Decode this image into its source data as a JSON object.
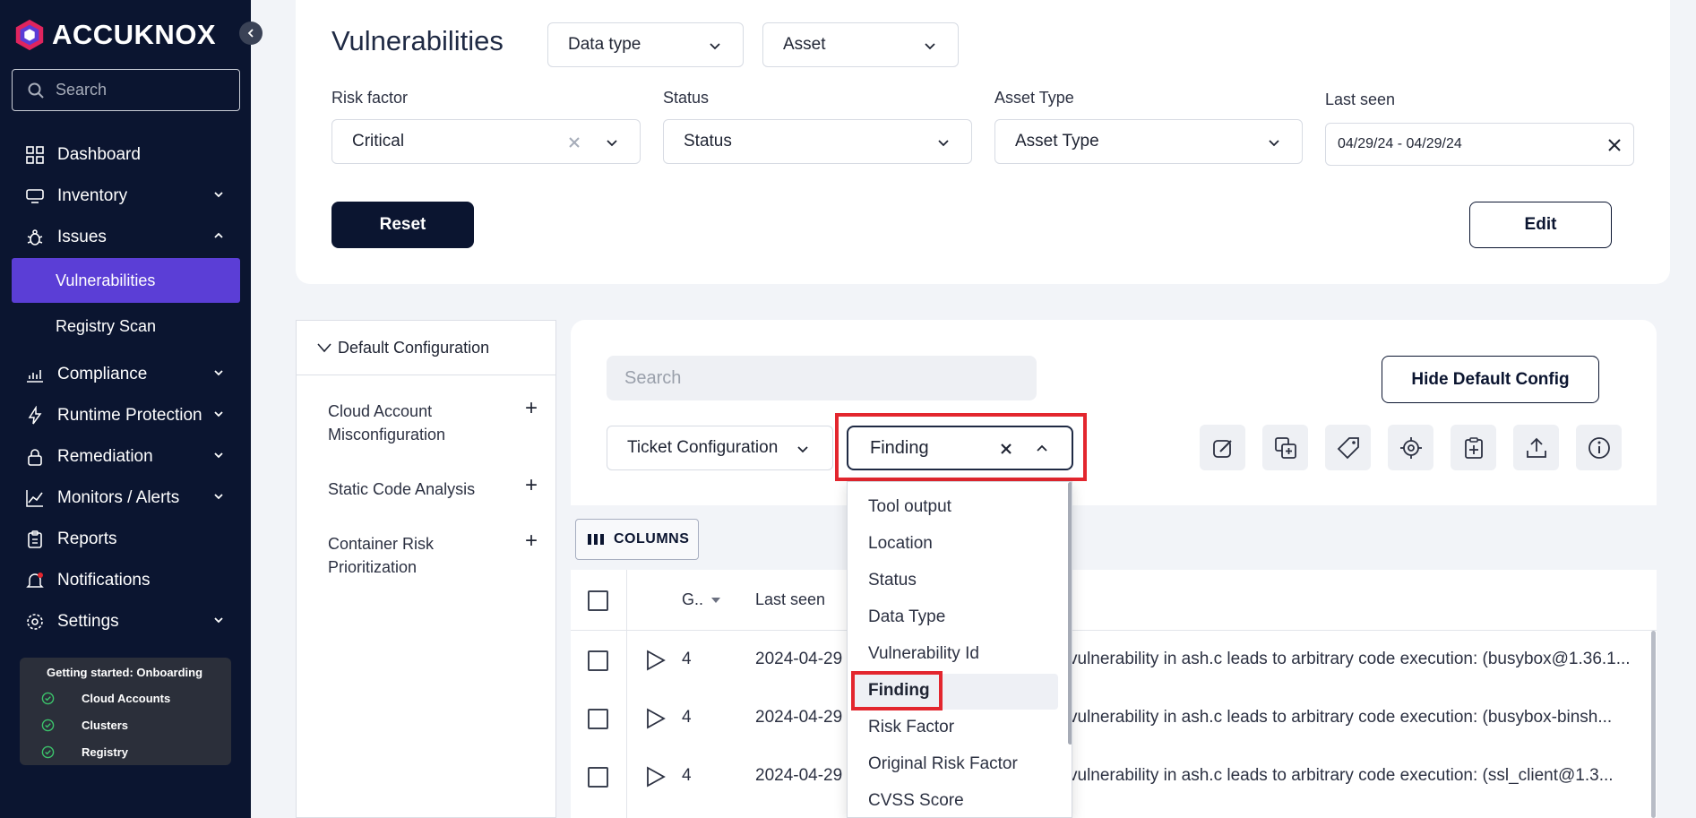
{
  "brand": {
    "name": "ACCUKNOX",
    "accent": "#5b3ed6",
    "dark": "#0b1530",
    "highlight": "#e3262e"
  },
  "sidebar": {
    "search_placeholder": "Search",
    "items": [
      {
        "label": "Dashboard",
        "icon": "dashboard-icon"
      },
      {
        "label": "Inventory",
        "icon": "inventory-icon"
      },
      {
        "label": "Issues",
        "icon": "bug-icon"
      },
      {
        "label": "Vulnerabilities"
      },
      {
        "label": "Registry Scan"
      },
      {
        "label": "Compliance",
        "icon": "compliance-icon"
      },
      {
        "label": "Runtime Protection",
        "icon": "bolt-icon"
      },
      {
        "label": "Remediation",
        "icon": "lock-icon"
      },
      {
        "label": "Monitors / Alerts",
        "icon": "chart-line-icon"
      },
      {
        "label": "Reports",
        "icon": "clipboard-icon"
      },
      {
        "label": "Notifications",
        "icon": "bell-icon"
      },
      {
        "label": "Settings",
        "icon": "gear-icon"
      }
    ],
    "onboarding": {
      "title": "Getting started: Onboarding",
      "steps": [
        "Cloud Accounts",
        "Clusters",
        "Registry"
      ]
    }
  },
  "header": {
    "title": "Vulnerabilities",
    "data_type": "Data type",
    "asset": "Asset"
  },
  "filters": {
    "risk_factor_label": "Risk factor",
    "risk_factor_value": "Critical",
    "status_label": "Status",
    "status_value": "Status",
    "asset_type_label": "Asset Type",
    "asset_type_value": "Asset Type",
    "last_seen_label": "Last seen",
    "last_seen_value": "04/29/24 - 04/29/24",
    "reset_label": "Reset",
    "edit_label": "Edit"
  },
  "config_panel": {
    "title": "Default Configuration",
    "items": [
      "Cloud Account Misconfiguration",
      "Static Code Analysis",
      "Container Risk Prioritization"
    ]
  },
  "toolbar": {
    "search_placeholder": "Search",
    "hide_default_config": "Hide Default Config",
    "ticket_configuration": "Ticket Configuration",
    "group_by_value": "Finding",
    "columns_label": "COLUMNS"
  },
  "dropdown": {
    "options": [
      "Tool output",
      "Location",
      "Status",
      "Data Type",
      "Vulnerability Id",
      "Finding",
      "Risk Factor",
      "Original Risk Factor",
      "CVSS Score"
    ],
    "selected": "Finding"
  },
  "table": {
    "headers": {
      "group": "G..",
      "last_seen": "Last seen"
    },
    "rows": [
      {
        "count": "4",
        "last_seen": "2024-04-29",
        "finding": "vulnerability in ash.c leads to arbitrary code execution: (busybox@1.36.1..."
      },
      {
        "count": "4",
        "last_seen": "2024-04-29",
        "finding": "vulnerability in ash.c leads to arbitrary code execution: (busybox-binsh..."
      },
      {
        "count": "4",
        "last_seen": "2024-04-29",
        "finding": "vulnerability in ash.c leads to arbitrary code execution: (ssl_client@1.3..."
      }
    ]
  }
}
